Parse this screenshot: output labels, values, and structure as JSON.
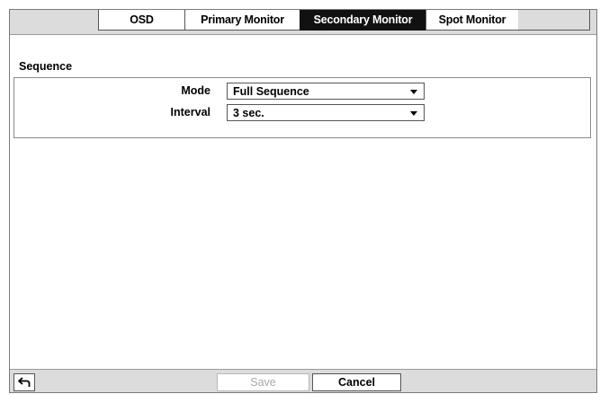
{
  "tabs": [
    {
      "label": "OSD",
      "active": false
    },
    {
      "label": "Primary Monitor",
      "active": false
    },
    {
      "label": "Secondary Monitor",
      "active": true
    },
    {
      "label": "Spot Monitor",
      "active": false
    }
  ],
  "section": {
    "title": "Sequence"
  },
  "fields": {
    "mode": {
      "label": "Mode",
      "value": "Full Sequence"
    },
    "interval": {
      "label": "Interval",
      "value": "3 sec."
    }
  },
  "footer": {
    "back_icon": "return-arrow-icon",
    "save_label": "Save",
    "save_enabled": false,
    "cancel_label": "Cancel"
  },
  "colors": {
    "active_tab_bg": "#111111",
    "window_bg": "#dcdcdc",
    "disabled_text": "#a9a9a9"
  }
}
